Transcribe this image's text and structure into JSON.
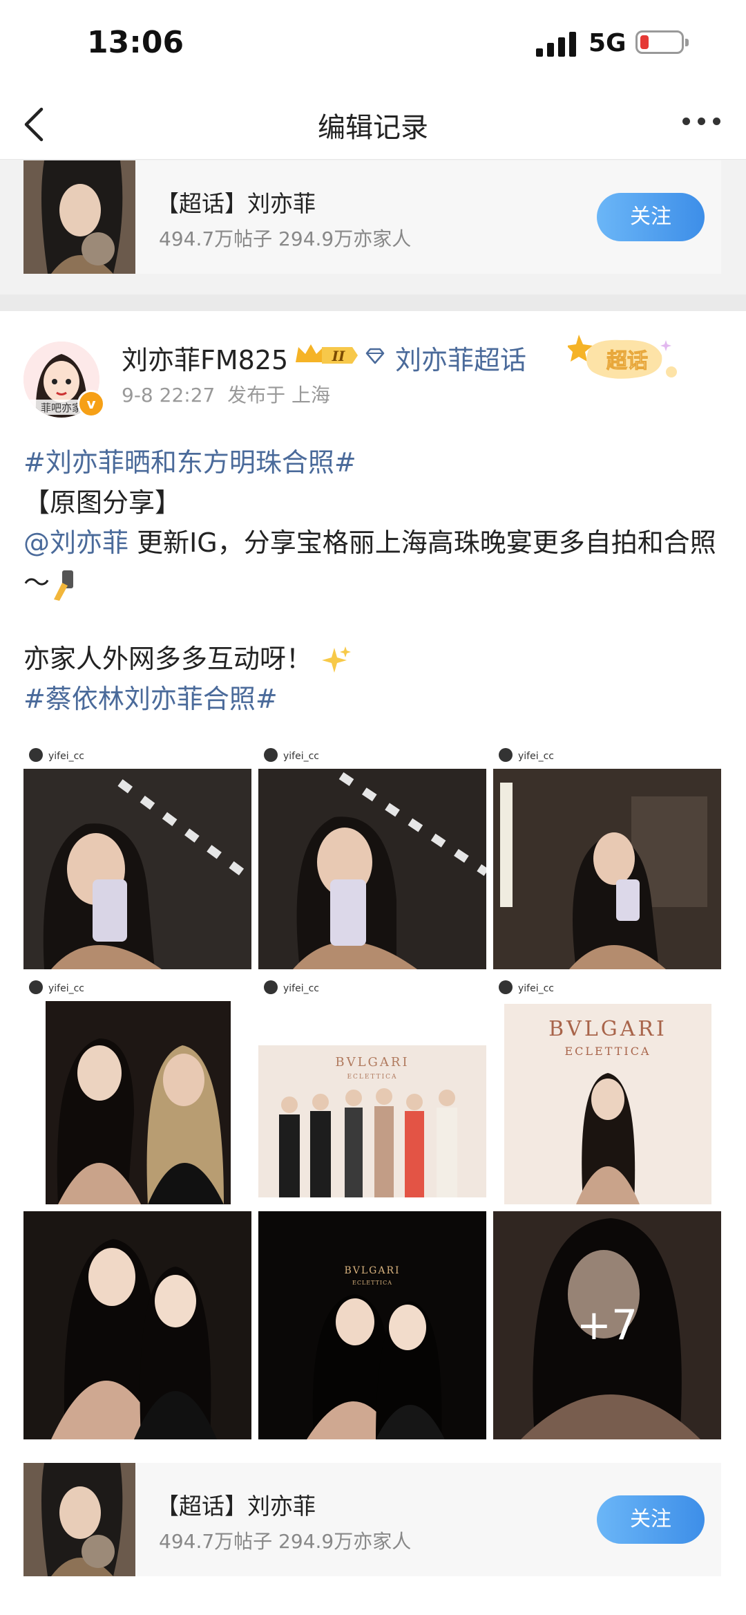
{
  "status": {
    "time": "13:06",
    "network": "5G"
  },
  "nav": {
    "title": "编辑记录"
  },
  "topic_card": {
    "title": "【超话】刘亦菲",
    "stats": "494.7万帖子 294.9万亦家人",
    "follow_label": "关注"
  },
  "post": {
    "username": "刘亦菲FM825",
    "level_badge": "II",
    "topic_link": "刘亦菲超话",
    "avatar_text": "菲吧亦家",
    "sticker_text": "超话",
    "time": "9-8 22:27",
    "location": "发布于 上海",
    "hashtag1": "#刘亦菲晒和东方明珠合照#",
    "line2": "【原图分享】",
    "mention": "@刘亦菲",
    "body1": " 更新IG，分享宝格丽上海高珠晚宴更多自拍和合照～",
    "body2": "亦家人外网多多互动呀！",
    "hashtag2": "#蔡依林刘亦菲合照#",
    "ig_handle": "yifei_cc",
    "brand_1": "BVLGARI",
    "brand_1_sub": "ECLETTICA",
    "brand_2": "BVLGARI",
    "brand_2_sub": "ECLETTICA",
    "brand_3": "BVLGARI",
    "brand_3_sub": "ECLETTICA",
    "more_photos": "+7"
  },
  "colors": {
    "link": "#4a6a9a",
    "follow_start": "#6bb6f7",
    "follow_end": "#3d8ee8",
    "vip": "#f6a016"
  }
}
